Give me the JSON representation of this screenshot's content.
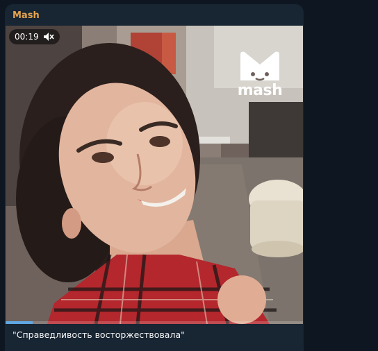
{
  "post": {
    "channel_name": "Mash",
    "caption": "\"Справедливость восторжествовала\""
  },
  "video": {
    "duration_label": "00:19",
    "watermark_text": "mash",
    "progress_fraction": 0.09,
    "muted": true
  },
  "icons": {
    "mute": "speaker-muted-icon",
    "logo": "mash-logo-icon"
  },
  "colors": {
    "channel_name": "#e6a44c",
    "bubble_bg": "#182533",
    "chat_bg": "#0e1621",
    "progress": "#5fa7e0"
  }
}
